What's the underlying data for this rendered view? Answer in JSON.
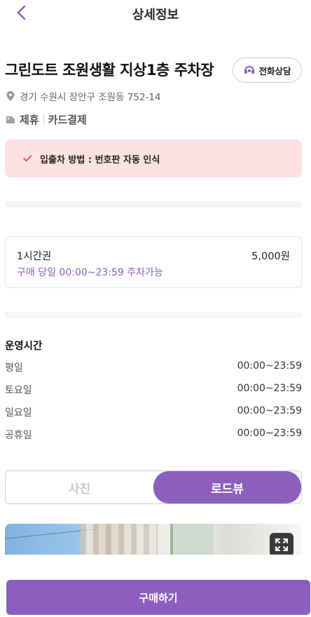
{
  "header": {
    "title": "상세정보",
    "back_icon": "chevron-left-icon"
  },
  "lot": {
    "title": "그린도트 조원생활 지상1층 주차장",
    "call_button_label": "전화상담",
    "address": "경기 수원시 장안구 조원동 752-14",
    "tags": [
      "제휴",
      "카드결제"
    ]
  },
  "notice": {
    "text": "입출차 방법 : 번호판 자동 인식"
  },
  "ticket": {
    "name": "1시간권",
    "price": "5,000원",
    "description": "구매 당일 00:00~23:59 주차가능"
  },
  "hours": {
    "title": "운영시간",
    "rows": [
      {
        "day": "평일",
        "time": "00:00~23:59"
      },
      {
        "day": "토요일",
        "time": "00:00~23:59"
      },
      {
        "day": "일요일",
        "time": "00:00~23:59"
      },
      {
        "day": "공휴일",
        "time": "00:00~23:59"
      }
    ]
  },
  "media_tabs": {
    "photo_label": "사진",
    "roadview_label": "로드뷰",
    "selected": "로드뷰"
  },
  "footer": {
    "buy_label": "구매하기"
  },
  "colors": {
    "accent": "#8c5fbf",
    "notice_bg": "#fde2df",
    "notice_check": "#d9534f"
  }
}
